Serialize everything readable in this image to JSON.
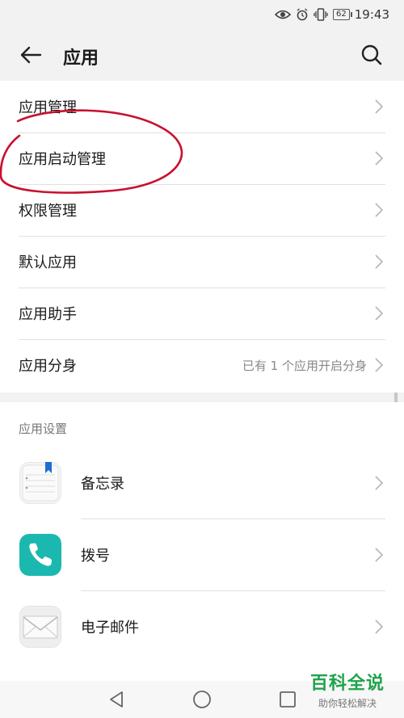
{
  "status_bar": {
    "time": "19:43",
    "battery": "62",
    "icons": [
      "eye-icon",
      "alarm-icon",
      "vibrate-icon",
      "battery-icon"
    ]
  },
  "header": {
    "title": "应用",
    "back_icon": "back-arrow-icon",
    "search_icon": "search-icon"
  },
  "menu": {
    "items": [
      {
        "label": "应用管理",
        "value": ""
      },
      {
        "label": "应用启动管理",
        "value": ""
      },
      {
        "label": "权限管理",
        "value": ""
      },
      {
        "label": "默认应用",
        "value": ""
      },
      {
        "label": "应用助手",
        "value": ""
      },
      {
        "label": "应用分身",
        "value": "已有 1 个应用开启分身"
      }
    ]
  },
  "app_settings": {
    "header": "应用设置",
    "items": [
      {
        "label": "备忘录",
        "icon": "notepad-icon"
      },
      {
        "label": "拨号",
        "icon": "phone-icon"
      },
      {
        "label": "电子邮件",
        "icon": "mail-icon"
      }
    ]
  },
  "nav_bar": {
    "icons": [
      "back-triangle-icon",
      "home-circle-icon",
      "recents-square-icon"
    ]
  },
  "watermark": {
    "title": "百科全说",
    "subtitle": "助你轻松解决"
  },
  "colors": {
    "background": "#f2f2f2",
    "annotation_red": "#c8102e",
    "watermark_green": "#1fa34a",
    "phone_icon_teal": "#1bb8b0",
    "notepad_bookmark_blue": "#1a6fd1"
  }
}
